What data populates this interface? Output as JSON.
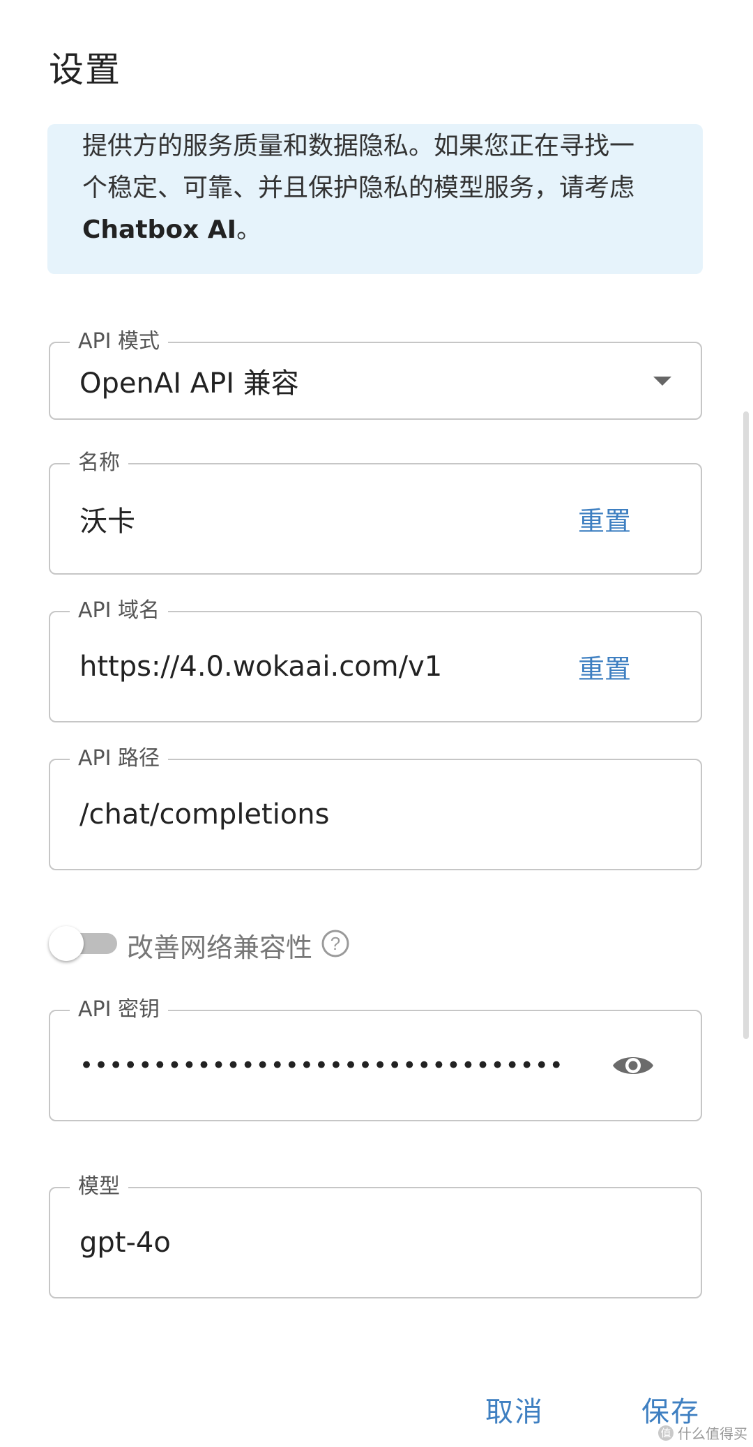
{
  "dialog": {
    "title": "设置"
  },
  "notice": {
    "line1": "提供方的服务质量和数据隐私。如果您正在寻找一",
    "line2": "个稳定、可靠、并且保护隐私的模型服务，请考虑",
    "brand": "Chatbox AI",
    "brand_suffix": "。"
  },
  "fields": {
    "api_mode": {
      "label": "API 模式",
      "value": "OpenAI API 兼容"
    },
    "name": {
      "label": "名称",
      "value": "沃卡",
      "reset": "重置"
    },
    "api_host": {
      "label": "API 域名",
      "value": "https://4.0.wokaai.com/v1",
      "reset": "重置"
    },
    "api_path": {
      "label": "API 路径",
      "value": "/chat/completions"
    },
    "api_key": {
      "label": "API 密钥",
      "masked_value": "•••••••••••••••••••••••••••••••••",
      "visibility_icon": "eye-icon"
    },
    "model": {
      "label": "模型",
      "value": "gpt-4o"
    }
  },
  "network_toggle": {
    "label": "改善网络兼容性",
    "enabled": false,
    "help_icon": "question-circle-icon"
  },
  "footer": {
    "cancel": "取消",
    "save": "保存"
  },
  "watermark": {
    "logo": "值",
    "text": "什么值得买"
  },
  "colors": {
    "accent": "#3e7fc1",
    "notice_bg": "#e6f3fb",
    "border": "#c6c6c6"
  }
}
